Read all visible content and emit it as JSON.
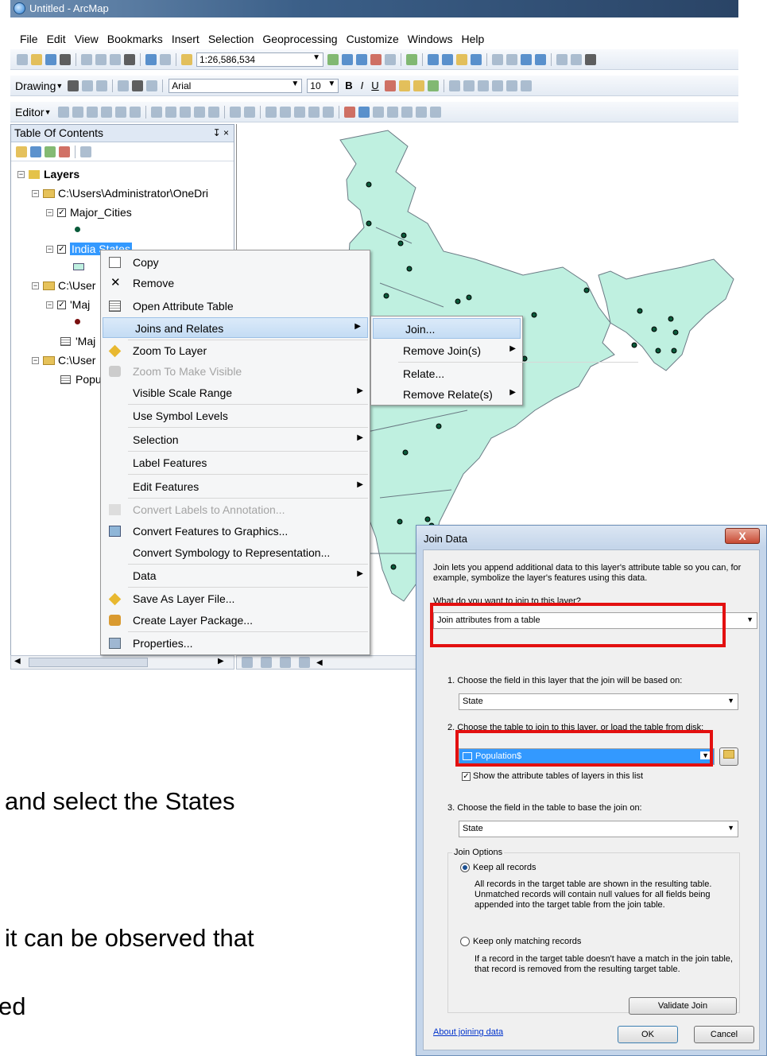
{
  "window": {
    "title": "Untitled - ArcMap"
  },
  "menu": [
    "File",
    "Edit",
    "View",
    "Bookmarks",
    "Insert",
    "Selection",
    "Geoprocessing",
    "Customize",
    "Windows",
    "Help"
  ],
  "toolbar": {
    "scale": "1:26,586,534",
    "drawing_label": "Drawing",
    "font_name": "Arial",
    "font_size": "10",
    "editor_label": "Editor"
  },
  "toc": {
    "title": "Table Of Contents",
    "pin": "↧ ×",
    "root": "Layers",
    "items": [
      "C:\\Users\\Administrator\\OneDri",
      "Major_Cities",
      "India States",
      "C:\\User",
      "'Maj",
      "'Maj",
      "C:\\User",
      "Popu"
    ]
  },
  "context_menu": {
    "items": [
      "Copy",
      "Remove",
      "Open Attribute Table",
      "Joins and Relates",
      "Zoom To Layer",
      "Zoom To Make Visible",
      "Visible Scale Range",
      "Use Symbol Levels",
      "Selection",
      "Label Features",
      "Edit Features",
      "Convert Labels to Annotation...",
      "Convert Features to Graphics...",
      "Convert Symbology to Representation...",
      "Data",
      "Save As Layer File...",
      "Create Layer Package...",
      "Properties..."
    ]
  },
  "submenu": {
    "items": [
      "Join...",
      "Remove Join(s)",
      "Relate...",
      "Remove Relate(s)"
    ]
  },
  "doc": {
    "line1": "and select the States",
    "line2": "it can be observed that",
    "line3": "ed"
  },
  "dialog": {
    "title": "Join Data",
    "close": "X",
    "intro": "Join lets you append additional data to this layer's attribute table so you can, for example, symbolize the layer's features using this data.",
    "question": "What do you want to join to this layer?",
    "join_type": "Join attributes from a table",
    "step1": "1.  Choose the field in this layer that the join will be based on:",
    "field1": "State",
    "step2": "2.  Choose the table to join to this layer, or load the table from disk:",
    "table": "Population$",
    "show_tables": "Show the attribute tables of layers in this list",
    "step3": "3.  Choose the field in the table to base the join on:",
    "field3": "State",
    "options_label": "Join Options",
    "keep_all": "Keep all records",
    "keep_all_desc": "All records in the target table are shown in the resulting table. Unmatched records will contain null values for all fields being appended into the target table from the join table.",
    "keep_match": "Keep only matching records",
    "keep_match_desc": "If a record in the target table doesn't have a match in the join table, that record is removed from the resulting target table.",
    "validate": "Validate Join",
    "about": "About joining data",
    "ok": "OK",
    "cancel": "Cancel"
  },
  "colors": {
    "map_fill": "#bff0e0",
    "highlight": "#3399ff",
    "red_box": "#e31010"
  }
}
